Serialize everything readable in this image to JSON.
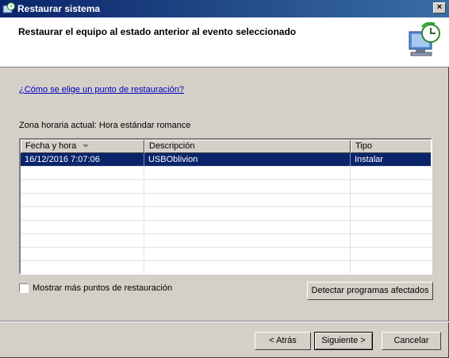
{
  "window": {
    "title": "Restaurar sistema",
    "close_label": "×"
  },
  "header": {
    "heading": "Restaurar el equipo al estado anterior al evento seleccionado"
  },
  "help_link": "¿Cómo se elige un punto de restauración?",
  "timezone_text": "Zona horaria actual: Hora estándar romance",
  "table": {
    "columns": [
      "Fecha y hora",
      "Descripción",
      "Tipo"
    ],
    "rows": [
      {
        "date": "16/12/2016 7:07:06",
        "description": "USBOblivion",
        "type": "Instalar",
        "selected": true
      }
    ]
  },
  "more_points_label": "Mostrar más puntos de restauración",
  "buttons": {
    "detect": "Detectar programas afectados",
    "back": "< Atrás",
    "next": "Siguiente >",
    "cancel": "Cancelar"
  },
  "colors": {
    "titlebar_start": "#0a246a",
    "titlebar_end": "#3a6ea5",
    "selection": "#0a246a",
    "link": "#0000c0"
  },
  "icons": {
    "app": "system-restore-icon",
    "wizard": "system-restore-clock-icon"
  }
}
